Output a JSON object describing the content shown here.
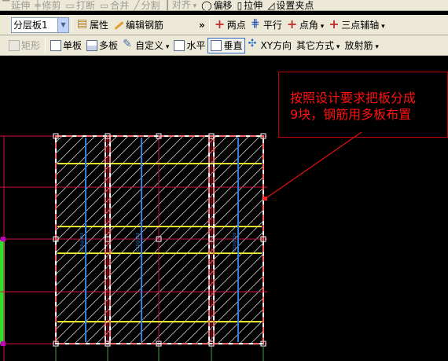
{
  "toolbar1": {
    "items": [
      "延伸",
      "修剪",
      "打断",
      "合并",
      "分割",
      "对齐",
      "偏移",
      "拉伸",
      "设置夹点"
    ]
  },
  "toolbar2": {
    "floor_select": "分层板1",
    "property": "属性",
    "edit_rebar": "编辑钢筋",
    "more": "»",
    "two_point": "两点",
    "parallel": "平行",
    "point_angle": "点角",
    "three_point_aux": "三点辅轴"
  },
  "toolbar3": {
    "rectangle": "矩形",
    "single_board": "单板",
    "multi_board": "多板",
    "custom": "自定义",
    "horizontal": "水平",
    "vertical": "垂直",
    "xy_direction": "XY方向",
    "other_method": "其它方式",
    "radial": "放射筋"
  },
  "callout": {
    "line1": "按照设计要求把板分成",
    "line2": "9块，钢筋用多板布置"
  },
  "colors": {
    "yellow_rebar": "#e8e830",
    "blue_rebar": "#2f7fe0",
    "red_axis": "#d01040",
    "slab_dash": "#ff6a6a",
    "callout_red": "#ff1010"
  }
}
